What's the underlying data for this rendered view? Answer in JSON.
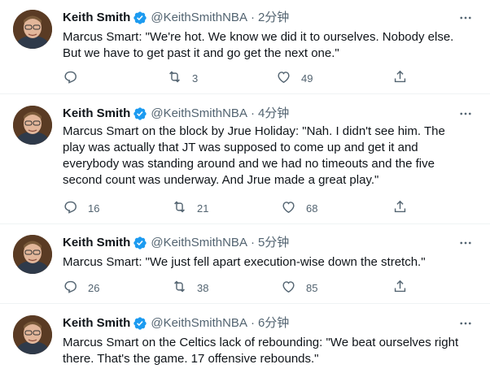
{
  "tweets": [
    {
      "name": "Keith Smith",
      "handle": "@KeithSmithNBA",
      "sep": "·",
      "time": "2分钟",
      "text": "Marcus Smart: \"We're hot. We know we did it to ourselves. Nobody else. But we have to get past it and go get the next one.\"",
      "replies": "",
      "retweets": "3",
      "likes": "49"
    },
    {
      "name": "Keith Smith",
      "handle": "@KeithSmithNBA",
      "sep": "·",
      "time": "4分钟",
      "text": "Marcus Smart on the block by Jrue Holiday: \"Nah. I didn't see him. The play was actually that JT was supposed to come up and get it and everybody was standing around and we had no timeouts and the five second count was underway. And Jrue made a great play.\"",
      "replies": "16",
      "retweets": "21",
      "likes": "68"
    },
    {
      "name": "Keith Smith",
      "handle": "@KeithSmithNBA",
      "sep": "·",
      "time": "5分钟",
      "text": "Marcus Smart: \"We just fell apart execution-wise down the stretch.\"",
      "replies": "26",
      "retweets": "38",
      "likes": "85"
    },
    {
      "name": "Keith Smith",
      "handle": "@KeithSmithNBA",
      "sep": "·",
      "time": "6分钟",
      "text": "Marcus Smart on the Celtics lack of rebounding: \"We beat ourselves right there. That's the game. 17 offensive rebounds.\"",
      "replies": "",
      "retweets": "",
      "likes": ""
    }
  ],
  "icons": {
    "verified": "verified-badge-icon",
    "more": "more-options-icon",
    "reply": "reply-icon",
    "retweet": "retweet-icon",
    "like": "like-icon",
    "share": "share-icon"
  },
  "colors": {
    "text": "#0f1419",
    "secondary": "#536471",
    "verified": "#1d9bf0",
    "divider": "#eff3f4"
  }
}
